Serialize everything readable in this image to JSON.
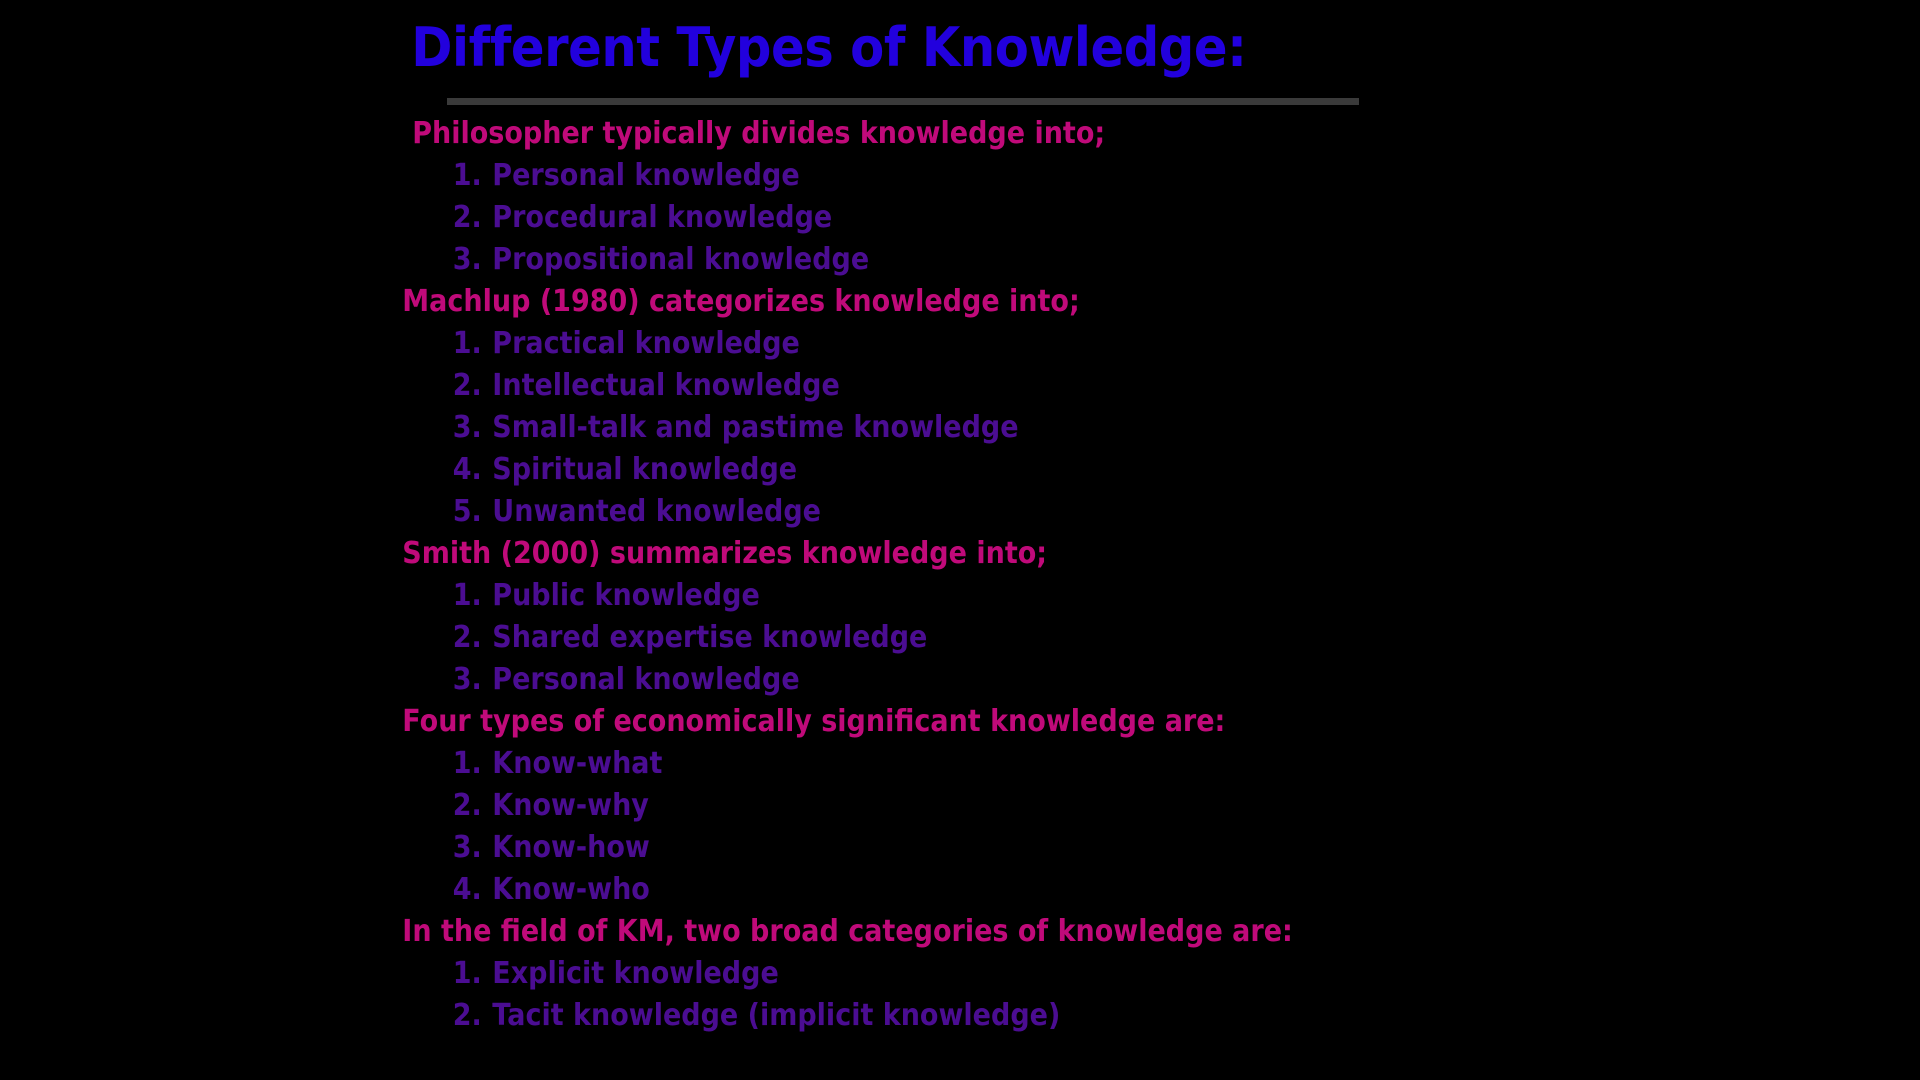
{
  "slide": {
    "background_color": "#000000",
    "title": "Different Types of Knowledge:",
    "title_color": "#2200DD",
    "rule_color": "#3A3A3A",
    "heading_color": "#C00A7A",
    "item_color": "#4B0D92",
    "sections": [
      {
        "heading": "Philosopher typically divides knowledge into;",
        "heading_indent": "extra",
        "items": [
          {
            "num": "1.",
            "text": "Personal knowledge"
          },
          {
            "num": "2.",
            "text": "Procedural knowledge"
          },
          {
            "num": "3.",
            "text": "Propositional knowledge"
          }
        ]
      },
      {
        "heading": "Machlup (1980) categorizes knowledge into;",
        "heading_indent": "normal",
        "items": [
          {
            "num": "1.",
            "text": "Practical knowledge"
          },
          {
            "num": "2.",
            "text": "Intellectual knowledge"
          },
          {
            "num": "3.",
            "text": "Small-talk and pastime knowledge"
          },
          {
            "num": "4.",
            "text": "Spiritual knowledge"
          },
          {
            "num": "5.",
            "text": "Unwanted knowledge"
          }
        ]
      },
      {
        "heading": "Smith (2000) summarizes knowledge into;",
        "heading_indent": "normal",
        "items": [
          {
            "num": "1.",
            "text": "Public knowledge"
          },
          {
            "num": "2.",
            "text": "Shared expertise knowledge"
          },
          {
            "num": "3.",
            "text": "Personal knowledge"
          }
        ]
      },
      {
        "heading": "Four types of economically significant knowledge are:",
        "heading_indent": "normal",
        "items": [
          {
            "num": "1.",
            "text": "Know-what"
          },
          {
            "num": "2.",
            "text": "Know-why"
          },
          {
            "num": "3.",
            "text": "Know-how"
          },
          {
            "num": "4.",
            "text": "Know-who"
          }
        ]
      },
      {
        "heading": "In the field of KM, two broad categories of knowledge are:",
        "heading_indent": "normal",
        "items": [
          {
            "num": "1.",
            "text": "Explicit knowledge"
          },
          {
            "num": "2.",
            "text": "Tacit knowledge (implicit knowledge)"
          }
        ]
      }
    ]
  }
}
